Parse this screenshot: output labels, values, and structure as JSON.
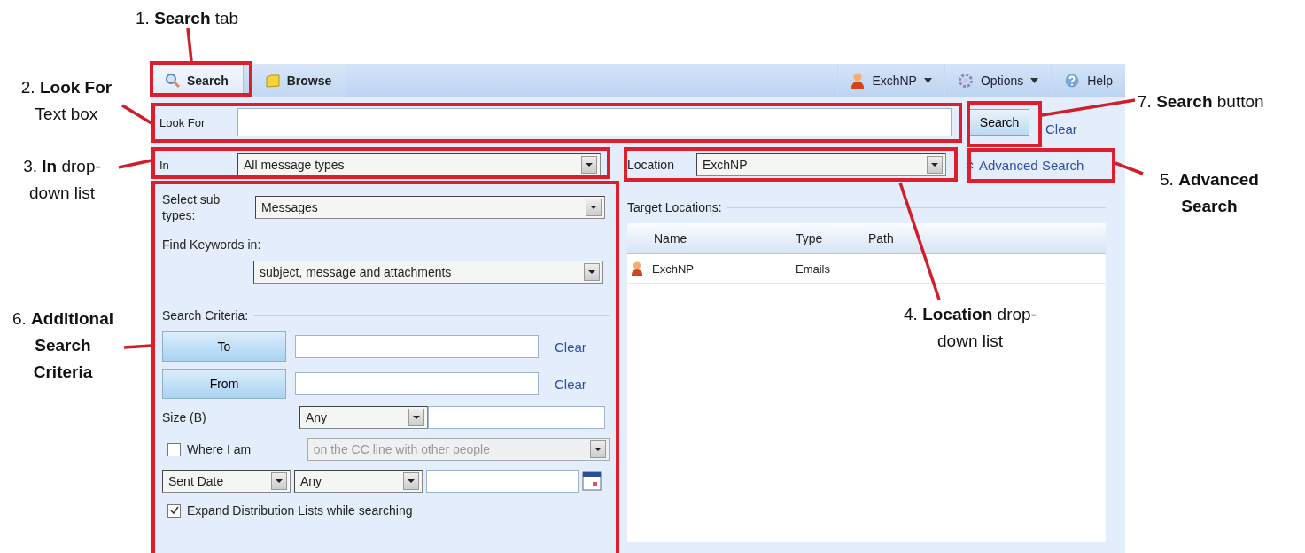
{
  "annotations": [
    {
      "text": "1. **Search** tab"
    },
    {
      "text": "2. **Look For**\nText box"
    },
    {
      "text": "3. **In** drop-\ndown list"
    },
    {
      "text": "4. **Location** drop-\ndown list"
    },
    {
      "text": "5. **Advanced**\n**Search**"
    },
    {
      "text": "6. **Additional**\n**Search**\n**Criteria**"
    },
    {
      "text": "7. **Search** button"
    }
  ],
  "toolbar": {
    "tabs": [
      {
        "label": "Search",
        "selected": true
      },
      {
        "label": "Browse",
        "selected": false
      }
    ],
    "menus": [
      {
        "label": "ExchNP",
        "kind": "user",
        "has_dropdown": true
      },
      {
        "label": "Options",
        "kind": "options",
        "has_dropdown": true
      },
      {
        "label": "Help",
        "kind": "help",
        "has_dropdown": false
      }
    ]
  },
  "look_for": {
    "label": "Look For"
  },
  "search_button": "Search",
  "clear_link": "Clear",
  "in": {
    "label": "In",
    "value": "All message types"
  },
  "location": {
    "label": "Location",
    "value": "ExchNP"
  },
  "advanced_search": "Advanced Search",
  "sub_types": {
    "label": "Select sub types:",
    "value": "Messages"
  },
  "find_keywords": {
    "label": "Find Keywords in:",
    "value": "subject, message and attachments"
  },
  "search_criteria": {
    "heading": "Search Criteria:",
    "recipients": [
      {
        "button": "To",
        "clear": "Clear"
      },
      {
        "button": "From",
        "clear": "Clear"
      }
    ],
    "size": {
      "label": "Size (B)",
      "operator": "Any"
    },
    "where_i_am": {
      "label": "Where I am",
      "checked": false,
      "value": "on the CC line with other people",
      "disabled": true
    },
    "date": {
      "field": "Sent Date",
      "operator": "Any"
    },
    "expand_lists": {
      "label": "Expand Distribution Lists while searching",
      "checked": true
    }
  },
  "target_locations": {
    "heading": "Target Locations:",
    "columns": [
      "Name",
      "Type",
      "Path"
    ],
    "rows": [
      {
        "name": "ExchNP",
        "type": "Emails"
      }
    ]
  }
}
